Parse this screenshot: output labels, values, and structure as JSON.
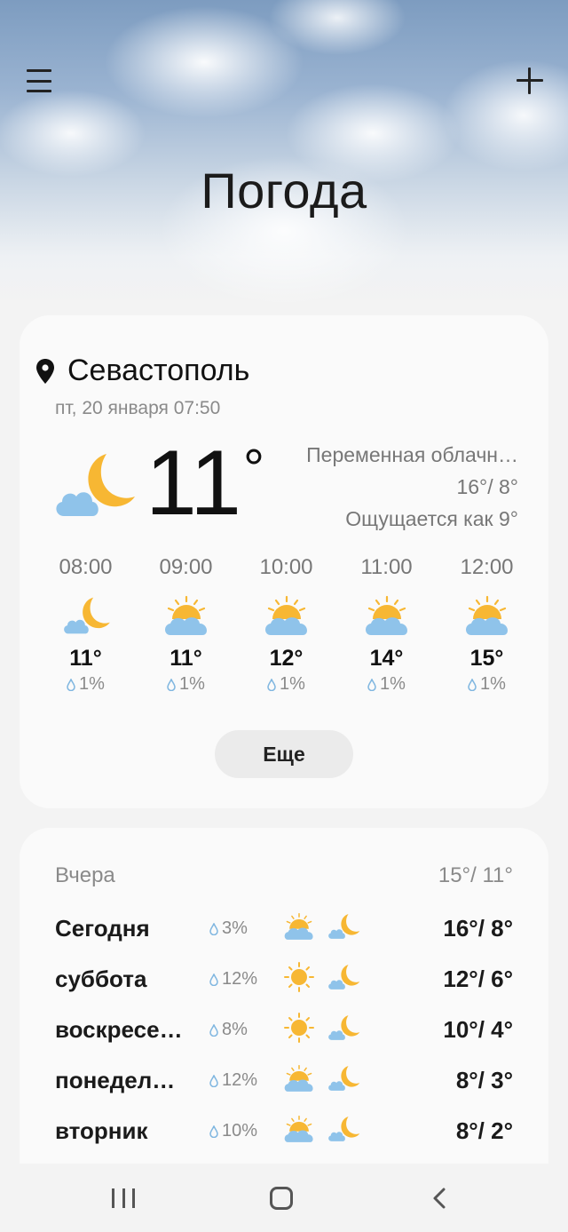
{
  "header": {
    "title": "Погода",
    "menu_icon": "hamburger-menu-icon",
    "add_icon": "plus-icon"
  },
  "current": {
    "city": "Севастополь",
    "datetime": "пт, 20 января 07:50",
    "temperature": "11",
    "degree_sign": "°",
    "condition": "Переменная облачн…",
    "high_low": "16°/ 8°",
    "feels_like": "Ощущается как 9°",
    "icon": "night-cloudy-moon-icon"
  },
  "hourly": [
    {
      "time": "08:00",
      "icon": "night-cloudy-moon-icon",
      "temp": "11°",
      "precip": "1%"
    },
    {
      "time": "09:00",
      "icon": "partly-sunny-icon",
      "temp": "11°",
      "precip": "1%"
    },
    {
      "time": "10:00",
      "icon": "partly-sunny-icon",
      "temp": "12°",
      "precip": "1%"
    },
    {
      "time": "11:00",
      "icon": "partly-sunny-icon",
      "temp": "14°",
      "precip": "1%"
    },
    {
      "time": "12:00",
      "icon": "partly-sunny-icon",
      "temp": "15°",
      "precip": "1%"
    }
  ],
  "more_button": "Еще",
  "daily": {
    "yesterday_label": "Вчера",
    "yesterday_temps": "15°/ 11°",
    "days": [
      {
        "name": "Сегодня",
        "precip": "3%",
        "day_icon": "partly-sunny-icon",
        "night_icon": "night-cloudy-moon-icon",
        "temps": "16°/ 8°"
      },
      {
        "name": "суббота",
        "precip": "12%",
        "day_icon": "sun-icon",
        "night_icon": "night-cloudy-moon-icon",
        "temps": "12°/ 6°"
      },
      {
        "name": "воскресе…",
        "precip": "8%",
        "day_icon": "sun-icon",
        "night_icon": "night-cloudy-moon-icon",
        "temps": "10°/ 4°"
      },
      {
        "name": "понедел…",
        "precip": "12%",
        "day_icon": "partly-sunny-icon",
        "night_icon": "night-cloudy-moon-icon",
        "temps": "8°/ 3°"
      },
      {
        "name": "вторник",
        "precip": "10%",
        "day_icon": "partly-sunny-icon",
        "night_icon": "night-cloudy-moon-icon",
        "temps": "8°/ 2°"
      }
    ]
  },
  "colors": {
    "sun": "#f7b733",
    "cloud": "#8fc3ea",
    "card": "#fafafa",
    "background": "#f3f3f3",
    "drop": "#7fb6e0"
  }
}
